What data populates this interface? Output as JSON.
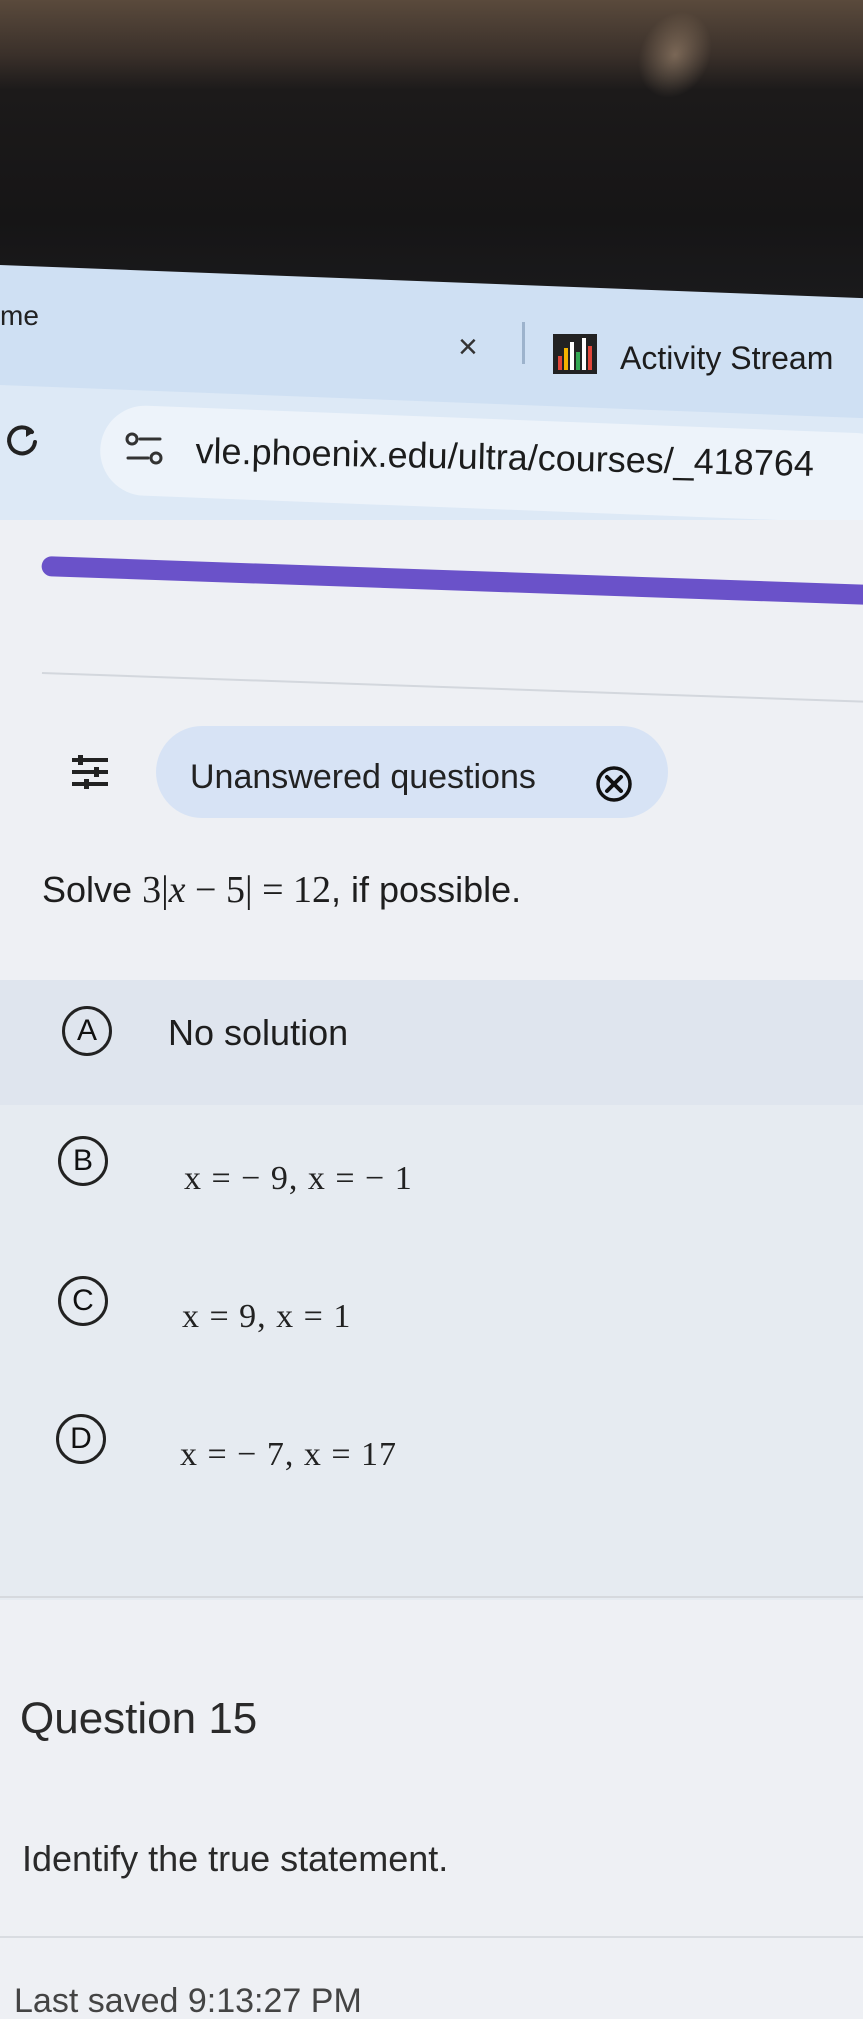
{
  "browser": {
    "left_tab_fragment": "me",
    "tab_close_symbol": "×",
    "active_tab_title": "Activity Stream",
    "url": "vle.phoenix.edu/ultra/courses/_418764"
  },
  "filter": {
    "chip_label": "Unanswered questions"
  },
  "question": {
    "prefix": "Solve ",
    "equation_parts": [
      "3",
      "|",
      "x",
      " − 5",
      "|",
      " = 12"
    ],
    "suffix": ", if possible."
  },
  "options": [
    {
      "letter": "A",
      "text": "No solution"
    },
    {
      "letter": "B",
      "text": "x = − 9, x = − 1"
    },
    {
      "letter": "C",
      "text": "x = 9, x = 1"
    },
    {
      "letter": "D",
      "text": "x = − 7, x = 17"
    }
  ],
  "next_question": {
    "title": "Question 15",
    "prompt": "Identify the true statement."
  },
  "status": {
    "last_saved": "Last saved 9:13:27 PM"
  },
  "colors": {
    "progress_bar": "#6a52c9",
    "chip_background": "#d7e3f5",
    "tab_strip": "#cfe0f3"
  }
}
